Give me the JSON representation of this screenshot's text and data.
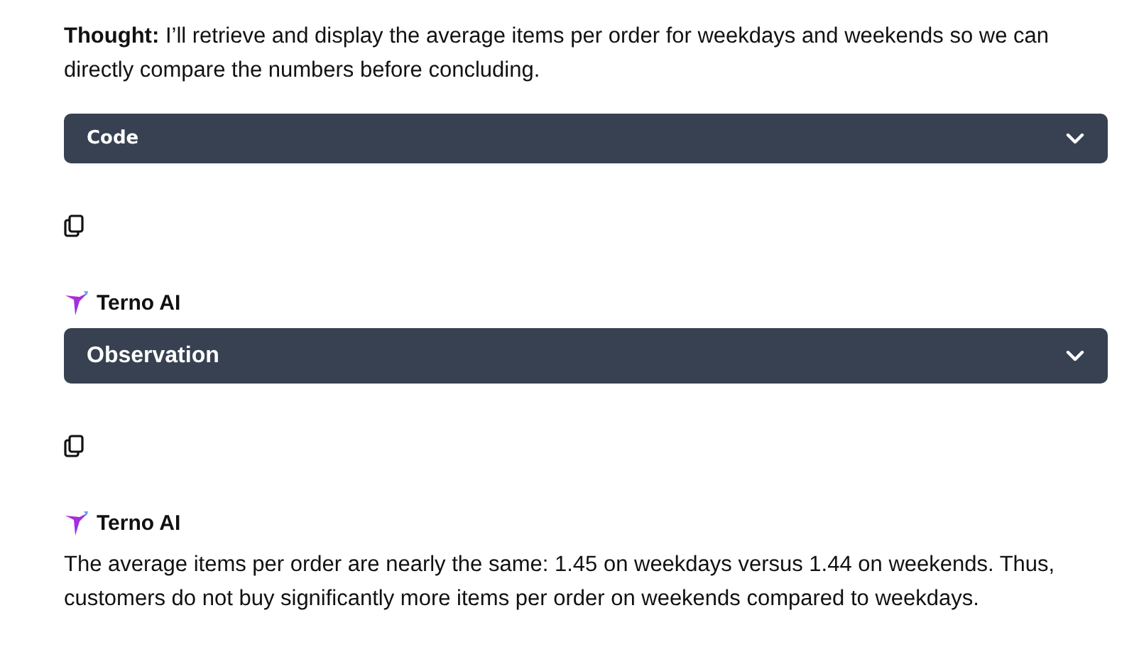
{
  "blocks": [
    {
      "kind": "thought",
      "text": "**Thought:** I’ll retrieve and display the average items per order for weekdays and weekends so we can directly compare the numbers before concluding."
    },
    {
      "kind": "code",
      "title": "Code",
      "expanded": false
    },
    {
      "kind": "copy"
    },
    {
      "kind": "author",
      "name": "Terno AI"
    },
    {
      "kind": "panel",
      "title": "Observation",
      "expanded": false
    },
    {
      "kind": "copy"
    },
    {
      "kind": "author",
      "name": "Terno AI"
    },
    {
      "kind": "answer",
      "text": "The average items per order are nearly the same: 1.45 on weekdays versus 1.44 on weekends. Thus, customers do not buy significantly more items per order on weekends compared to weekdays."
    }
  ]
}
